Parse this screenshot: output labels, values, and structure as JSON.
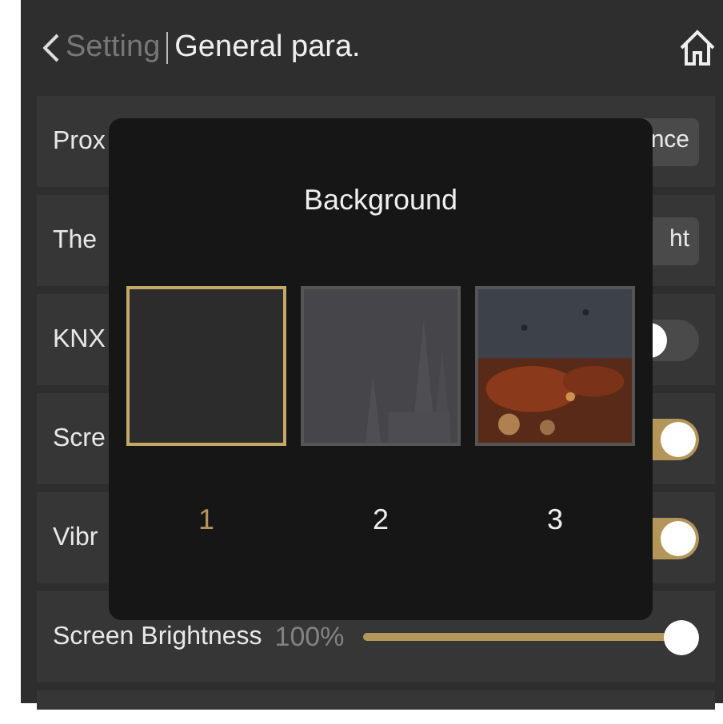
{
  "header": {
    "back_label": "Setting",
    "title": "General para."
  },
  "settings": [
    {
      "kind": "segmented",
      "label": "Prox",
      "options": [
        {
          "label": "nce"
        }
      ]
    },
    {
      "kind": "segmented",
      "label": "The",
      "options": [
        {
          "label": "ht"
        }
      ]
    },
    {
      "kind": "switch",
      "label": "KNX",
      "on": false
    },
    {
      "kind": "switch",
      "label": "Scre",
      "on": true
    },
    {
      "kind": "switch",
      "label": "Vibr",
      "on": true
    },
    {
      "kind": "slider",
      "label": "Screen Brightness",
      "reading": "100%",
      "level": 1
    }
  ],
  "dialog": {
    "title": "Background",
    "options": [
      {
        "kind": "plain",
        "label": "1",
        "selected": true
      },
      {
        "kind": "city",
        "label": "2",
        "selected": false
      },
      {
        "kind": "picture",
        "label": "3",
        "selected": false
      }
    ]
  }
}
